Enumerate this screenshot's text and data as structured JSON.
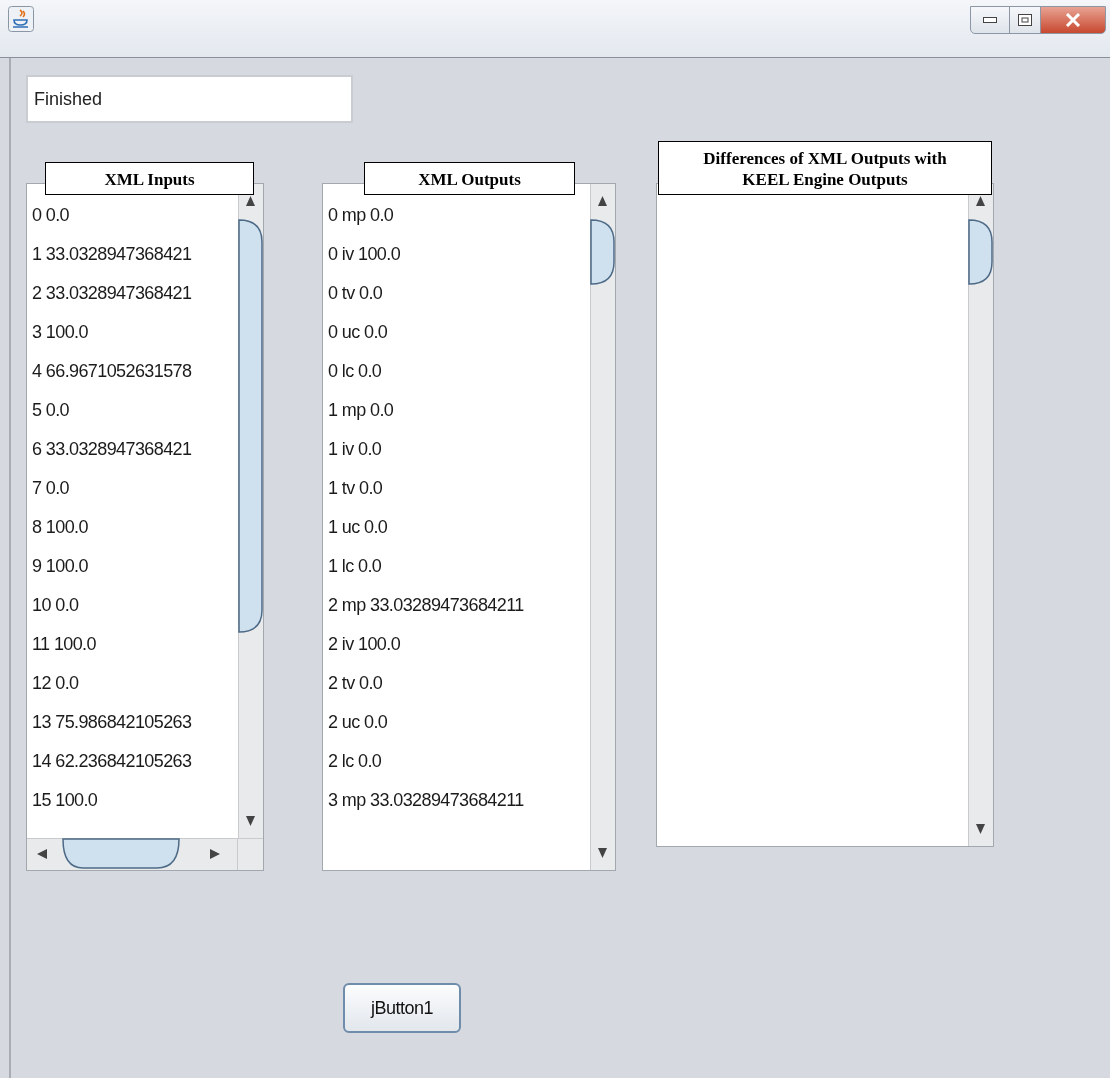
{
  "status_field": {
    "value": "Finished"
  },
  "panels": [
    {
      "title": "XML Inputs",
      "horizontal_scroll": true,
      "items": [
        "0 0.0",
        "1 33.0328947368421",
        "2 33.0328947368421",
        "3 100.0",
        "4 66.9671052631578",
        "5 0.0",
        "6 33.0328947368421",
        "7 0.0",
        "8 100.0",
        "9 100.0",
        "10 0.0",
        "11 100.0",
        "12 0.0",
        "13 75.986842105263",
        "14 62.236842105263",
        "15 100.0"
      ]
    },
    {
      "title": "XML Outputs",
      "horizontal_scroll": false,
      "items": [
        "0 mp 0.0",
        "0 iv 100.0",
        "0 tv 0.0",
        "0 uc 0.0",
        "0 lc 0.0",
        "1 mp 0.0",
        "1 iv 0.0",
        "1 tv 0.0",
        "1 uc 0.0",
        "1 lc 0.0",
        "2 mp 33.03289473684211",
        "2 iv 100.0",
        "2 tv 0.0",
        "2 uc 0.0",
        "2 lc 0.0",
        "3 mp 33.03289473684211"
      ]
    },
    {
      "title": "Differences of XML Outputs with KEEL Engine Outputs",
      "horizontal_scroll": false
    }
  ],
  "button": {
    "label": "jButton1"
  }
}
